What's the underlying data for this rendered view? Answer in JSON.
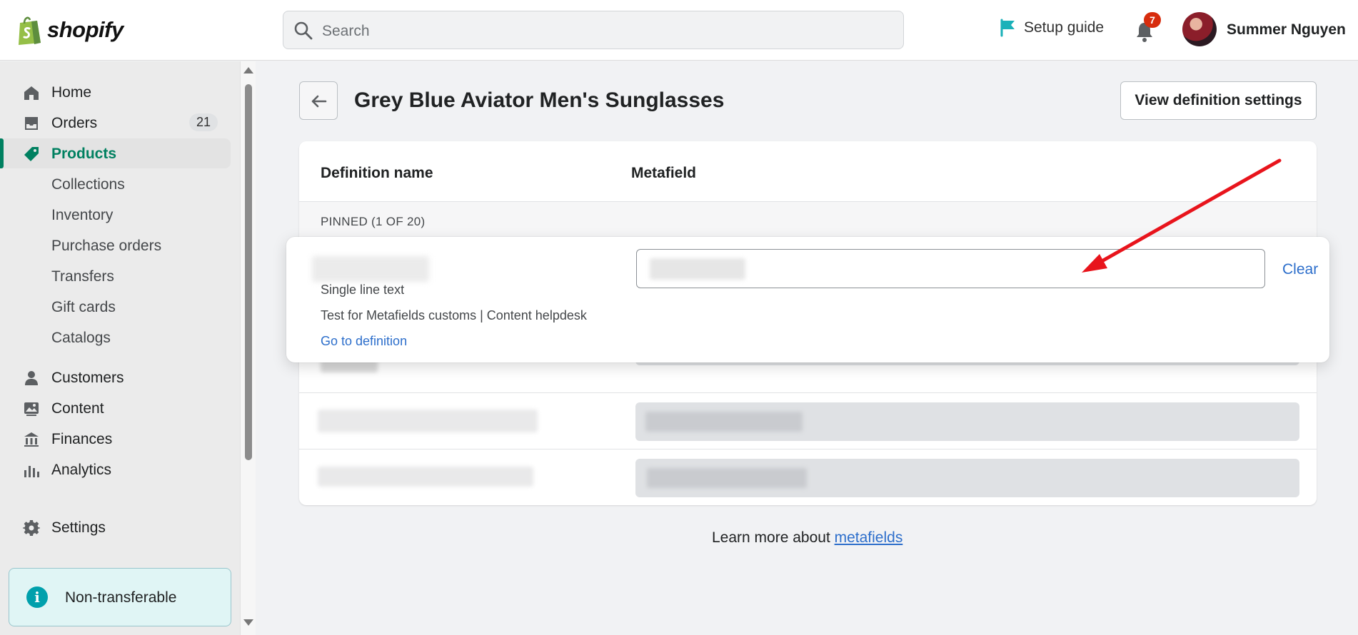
{
  "topbar": {
    "brand": "shopify",
    "search_placeholder": "Search",
    "setup_guide": "Setup guide",
    "notification_count": "7",
    "user_name": "Summer Nguyen"
  },
  "sidebar": {
    "items": [
      {
        "label": "Home",
        "icon": "home-icon"
      },
      {
        "label": "Orders",
        "icon": "orders-icon",
        "count": "21"
      },
      {
        "label": "Products",
        "icon": "tag-icon",
        "active": true
      },
      {
        "label": "Collections",
        "sub": true
      },
      {
        "label": "Inventory",
        "sub": true
      },
      {
        "label": "Purchase orders",
        "sub": true
      },
      {
        "label": "Transfers",
        "sub": true
      },
      {
        "label": "Gift cards",
        "sub": true
      },
      {
        "label": "Catalogs",
        "sub": true
      },
      {
        "label": "Customers",
        "icon": "person-icon"
      },
      {
        "label": "Content",
        "icon": "image-icon"
      },
      {
        "label": "Finances",
        "icon": "bank-icon"
      },
      {
        "label": "Analytics",
        "icon": "bar-chart-icon"
      },
      {
        "label": "Settings",
        "icon": "gear-icon"
      }
    ],
    "notice": "Non-transferable"
  },
  "main": {
    "page_title": "Grey Blue Aviator Men's Sunglasses",
    "view_definition_button": "View definition settings",
    "table": {
      "col_definition": "Definition name",
      "col_metafield": "Metafield",
      "pinned_label": "PINNED (1 OF 20)"
    },
    "popover": {
      "type": "Single line text",
      "description": "Test for Metafields customs | Content helpdesk",
      "go_to_definition": "Go to definition",
      "clear": "Clear"
    },
    "learn_more_prefix": "Learn more about ",
    "learn_more_link": "metafields"
  },
  "colors": {
    "accent_green": "#008060",
    "link_blue": "#2c6ecb",
    "annotation_red": "#e8141c",
    "badge_red": "#d72c0d"
  }
}
